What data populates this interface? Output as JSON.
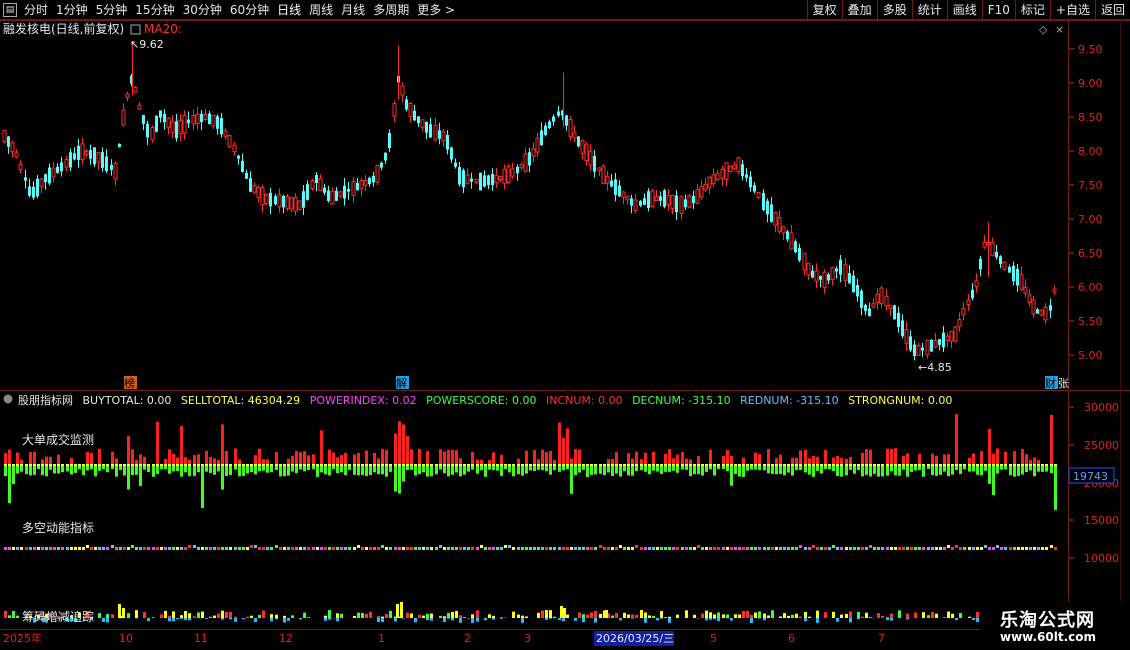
{
  "toolbar": {
    "periods": [
      "分时",
      "1分钟",
      "5分钟",
      "15分钟",
      "30分钟",
      "60分钟",
      "日线",
      "周线",
      "月线",
      "多周期",
      "更多 >"
    ],
    "active_period": "日线",
    "buttons": [
      "复权",
      "叠加",
      "多股",
      "统计",
      "画线",
      "F10",
      "标记",
      "+自选",
      "返回"
    ]
  },
  "main_panel": {
    "title": "融发核电(日线,前复权)",
    "indicator": "MA20:",
    "high_label": "9.62",
    "low_label": "4.85",
    "markers": [
      "榜",
      "解",
      "财",
      "张"
    ],
    "price_axis": [
      "9.50",
      "9.00",
      "8.50",
      "8.00",
      "7.50",
      "7.00",
      "6.50",
      "6.00",
      "5.50",
      "5.00"
    ],
    "colors": {
      "up": "#ff2a2a",
      "down": "#54ffff",
      "bg": "#000000",
      "grid": "#6e1a1a",
      "axis_text": "#e02020"
    }
  },
  "sub_panel": {
    "name": "股朋指标网",
    "fields": [
      {
        "label": "BUYTOTAL: 0.00",
        "color": "#e8e8e8"
      },
      {
        "label": "SELLTOTAL: 46304.29",
        "color": "#ffff40"
      },
      {
        "label": "POWERINDEX: 0.02",
        "color": "#ff40ff"
      },
      {
        "label": "POWERSCORE: 0.00",
        "color": "#40ff40"
      },
      {
        "label": "INCNUM: 0.00",
        "color": "#ff3030"
      },
      {
        "label": "DECNUM: -315.10",
        "color": "#40ff40"
      },
      {
        "label": "REDNUM: -315.10",
        "color": "#60c0ff"
      },
      {
        "label": "STRONGNUM: 0.00",
        "color": "#ffff40"
      }
    ],
    "section_labels": [
      "大单成交监测",
      "多空动能指标",
      "筹码增减追踪"
    ],
    "axis": [
      "30000",
      "25000",
      "20000",
      "15000",
      "10000"
    ],
    "current_value": "19743"
  },
  "time_axis": {
    "labels": [
      "2025年",
      "10",
      "11",
      "12",
      "1",
      "2",
      "3",
      "2026/03/25/三",
      "5",
      "6",
      "7"
    ]
  },
  "watermark": {
    "line1": "乐淘公式网",
    "line2": "www.60lt.com"
  }
}
